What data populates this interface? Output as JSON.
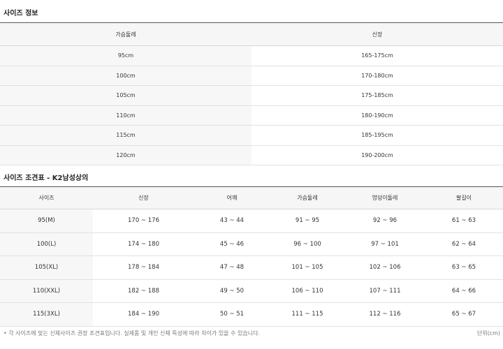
{
  "table1": {
    "title": "사이즈 정보",
    "headers": [
      "가슴둘레",
      "신장"
    ],
    "rows": [
      [
        "95cm",
        "165-175cm"
      ],
      [
        "100cm",
        "170-180cm"
      ],
      [
        "105cm",
        "175-185cm"
      ],
      [
        "110cm",
        "180-190cm"
      ],
      [
        "115cm",
        "185-195cm"
      ],
      [
        "120cm",
        "190-200cm"
      ]
    ]
  },
  "table2": {
    "title": "사이즈 조견표 - K2남성상의",
    "headers": [
      "사이즈",
      "신장",
      "어깨",
      "가슴둘레",
      "엉덩이둘레",
      "팔길이"
    ],
    "rows": [
      [
        "95(M)",
        "170 ~ 176",
        "43 ~ 44",
        "91 ~ 95",
        "92 ~ 96",
        "61 ~ 63"
      ],
      [
        "100(L)",
        "174 ~ 180",
        "45 ~ 46",
        "96 ~ 100",
        "97 ~ 101",
        "62 ~ 64"
      ],
      [
        "105(XL)",
        "178 ~ 184",
        "47 ~ 48",
        "101 ~ 105",
        "102 ~ 106",
        "63 ~ 65"
      ],
      [
        "110(XXL)",
        "182 ~ 188",
        "49 ~ 50",
        "106 ~ 110",
        "107 ~ 111",
        "64 ~ 66"
      ],
      [
        "115(3XL)",
        "184 ~ 190",
        "50 ~ 51",
        "111 ~ 115",
        "112 ~ 116",
        "65 ~ 67"
      ]
    ]
  },
  "footnote": "• 각 사이즈에 맞는 신체사이즈 권장 조견표입니다. 실제품 및 개인 신체 특성에 따라 차이가 있을 수 있습니다.",
  "unit": "단위(cm)"
}
